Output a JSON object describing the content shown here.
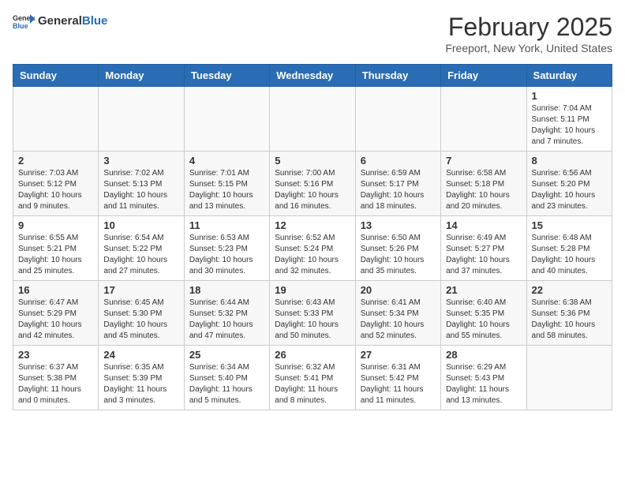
{
  "header": {
    "logo_general": "General",
    "logo_blue": "Blue",
    "main_title": "February 2025",
    "subtitle": "Freeport, New York, United States"
  },
  "weekdays": [
    "Sunday",
    "Monday",
    "Tuesday",
    "Wednesday",
    "Thursday",
    "Friday",
    "Saturday"
  ],
  "weeks": [
    [
      {
        "day": "",
        "info": ""
      },
      {
        "day": "",
        "info": ""
      },
      {
        "day": "",
        "info": ""
      },
      {
        "day": "",
        "info": ""
      },
      {
        "day": "",
        "info": ""
      },
      {
        "day": "",
        "info": ""
      },
      {
        "day": "1",
        "info": "Sunrise: 7:04 AM\nSunset: 5:11 PM\nDaylight: 10 hours and 7 minutes."
      }
    ],
    [
      {
        "day": "2",
        "info": "Sunrise: 7:03 AM\nSunset: 5:12 PM\nDaylight: 10 hours and 9 minutes."
      },
      {
        "day": "3",
        "info": "Sunrise: 7:02 AM\nSunset: 5:13 PM\nDaylight: 10 hours and 11 minutes."
      },
      {
        "day": "4",
        "info": "Sunrise: 7:01 AM\nSunset: 5:15 PM\nDaylight: 10 hours and 13 minutes."
      },
      {
        "day": "5",
        "info": "Sunrise: 7:00 AM\nSunset: 5:16 PM\nDaylight: 10 hours and 16 minutes."
      },
      {
        "day": "6",
        "info": "Sunrise: 6:59 AM\nSunset: 5:17 PM\nDaylight: 10 hours and 18 minutes."
      },
      {
        "day": "7",
        "info": "Sunrise: 6:58 AM\nSunset: 5:18 PM\nDaylight: 10 hours and 20 minutes."
      },
      {
        "day": "8",
        "info": "Sunrise: 6:56 AM\nSunset: 5:20 PM\nDaylight: 10 hours and 23 minutes."
      }
    ],
    [
      {
        "day": "9",
        "info": "Sunrise: 6:55 AM\nSunset: 5:21 PM\nDaylight: 10 hours and 25 minutes."
      },
      {
        "day": "10",
        "info": "Sunrise: 6:54 AM\nSunset: 5:22 PM\nDaylight: 10 hours and 27 minutes."
      },
      {
        "day": "11",
        "info": "Sunrise: 6:53 AM\nSunset: 5:23 PM\nDaylight: 10 hours and 30 minutes."
      },
      {
        "day": "12",
        "info": "Sunrise: 6:52 AM\nSunset: 5:24 PM\nDaylight: 10 hours and 32 minutes."
      },
      {
        "day": "13",
        "info": "Sunrise: 6:50 AM\nSunset: 5:26 PM\nDaylight: 10 hours and 35 minutes."
      },
      {
        "day": "14",
        "info": "Sunrise: 6:49 AM\nSunset: 5:27 PM\nDaylight: 10 hours and 37 minutes."
      },
      {
        "day": "15",
        "info": "Sunrise: 6:48 AM\nSunset: 5:28 PM\nDaylight: 10 hours and 40 minutes."
      }
    ],
    [
      {
        "day": "16",
        "info": "Sunrise: 6:47 AM\nSunset: 5:29 PM\nDaylight: 10 hours and 42 minutes."
      },
      {
        "day": "17",
        "info": "Sunrise: 6:45 AM\nSunset: 5:30 PM\nDaylight: 10 hours and 45 minutes."
      },
      {
        "day": "18",
        "info": "Sunrise: 6:44 AM\nSunset: 5:32 PM\nDaylight: 10 hours and 47 minutes."
      },
      {
        "day": "19",
        "info": "Sunrise: 6:43 AM\nSunset: 5:33 PM\nDaylight: 10 hours and 50 minutes."
      },
      {
        "day": "20",
        "info": "Sunrise: 6:41 AM\nSunset: 5:34 PM\nDaylight: 10 hours and 52 minutes."
      },
      {
        "day": "21",
        "info": "Sunrise: 6:40 AM\nSunset: 5:35 PM\nDaylight: 10 hours and 55 minutes."
      },
      {
        "day": "22",
        "info": "Sunrise: 6:38 AM\nSunset: 5:36 PM\nDaylight: 10 hours and 58 minutes."
      }
    ],
    [
      {
        "day": "23",
        "info": "Sunrise: 6:37 AM\nSunset: 5:38 PM\nDaylight: 11 hours and 0 minutes."
      },
      {
        "day": "24",
        "info": "Sunrise: 6:35 AM\nSunset: 5:39 PM\nDaylight: 11 hours and 3 minutes."
      },
      {
        "day": "25",
        "info": "Sunrise: 6:34 AM\nSunset: 5:40 PM\nDaylight: 11 hours and 5 minutes."
      },
      {
        "day": "26",
        "info": "Sunrise: 6:32 AM\nSunset: 5:41 PM\nDaylight: 11 hours and 8 minutes."
      },
      {
        "day": "27",
        "info": "Sunrise: 6:31 AM\nSunset: 5:42 PM\nDaylight: 11 hours and 11 minutes."
      },
      {
        "day": "28",
        "info": "Sunrise: 6:29 AM\nSunset: 5:43 PM\nDaylight: 11 hours and 13 minutes."
      },
      {
        "day": "",
        "info": ""
      }
    ]
  ]
}
